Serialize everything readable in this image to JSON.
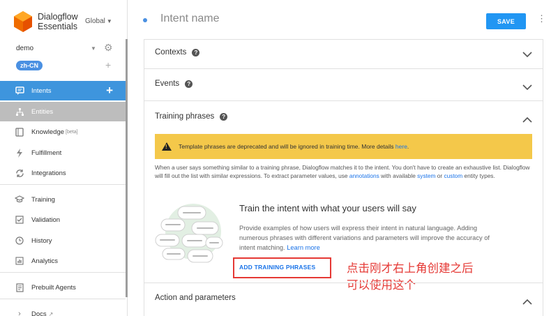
{
  "brand": {
    "name_line1": "Dialogflow",
    "name_line2": "Essentials",
    "region": "Global"
  },
  "agent": {
    "name": "demo",
    "language": "zh-CN"
  },
  "sidebar": {
    "items": [
      {
        "label": "Intents"
      },
      {
        "label": "Entities"
      },
      {
        "label": "Knowledge",
        "badge": "[beta]"
      },
      {
        "label": "Fulfillment"
      },
      {
        "label": "Integrations"
      },
      {
        "label": "Training"
      },
      {
        "label": "Validation"
      },
      {
        "label": "History"
      },
      {
        "label": "Analytics"
      },
      {
        "label": "Prebuilt Agents"
      },
      {
        "label": "Docs"
      }
    ]
  },
  "header": {
    "intent_name_placeholder": "Intent name",
    "save_label": "SAVE"
  },
  "sections": {
    "contexts": "Contexts",
    "events": "Events",
    "training_phrases": "Training phrases",
    "action_parameters": "Action and parameters"
  },
  "warning": {
    "text": "Template phrases are deprecated and will be ignored in training time. More details ",
    "link": "here",
    "tail": "."
  },
  "description": {
    "part1": "When a user says something similar to a training phrase, Dialogflow matches it to the intent. You don't have to create an exhaustive list. Dialogflow will fill out the list with similar expressions. To extract parameter values, use ",
    "link1": "annotations",
    "part2": " with available ",
    "link2": "system",
    "part3": " or ",
    "link3": "custom",
    "part4": " entity types."
  },
  "empty_state": {
    "title": "Train the intent with what your users will say",
    "body": "Provide examples of how users will express their intent in natural language. Adding numerous phrases with different variations and parameters will improve the accuracy of intent matching. ",
    "learn_more": "Learn more",
    "add_button": "ADD TRAINING PHRASES"
  },
  "annotation": {
    "line1": "点击刚才右上角创建之后",
    "line2": "可以使用这个"
  },
  "colors": {
    "accent": "#2196f3",
    "active_nav": "#3e95dd",
    "warning": "#f4c84a",
    "annotation": "#e53935"
  }
}
